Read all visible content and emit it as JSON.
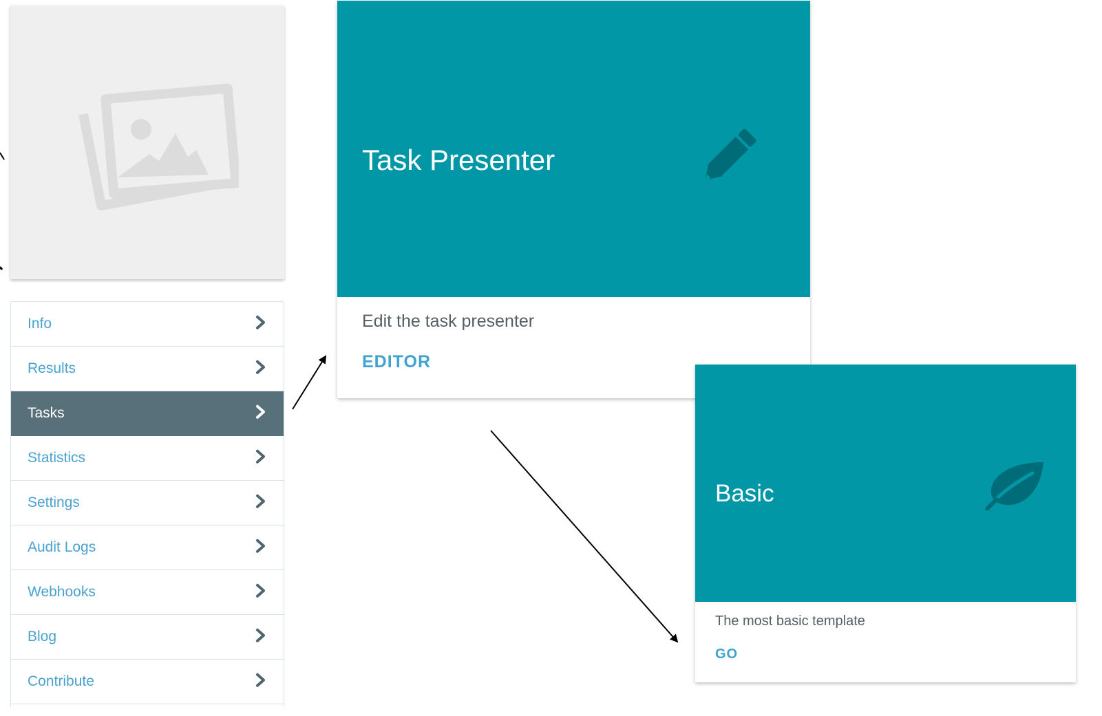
{
  "thumbnail": {
    "icon": "image-placeholder-icon"
  },
  "menu": {
    "items": [
      {
        "label": "Info",
        "active": false
      },
      {
        "label": "Results",
        "active": false
      },
      {
        "label": "Tasks",
        "active": true
      },
      {
        "label": "Statistics",
        "active": false
      },
      {
        "label": "Settings",
        "active": false
      },
      {
        "label": "Audit Logs",
        "active": false
      },
      {
        "label": "Webhooks",
        "active": false
      },
      {
        "label": "Blog",
        "active": false
      },
      {
        "label": "Contribute",
        "active": false
      }
    ]
  },
  "task_presenter_card": {
    "title": "Task Presenter",
    "description": "Edit the task presenter",
    "link": "EDITOR",
    "icon": "pencil-icon"
  },
  "basic_card": {
    "title": "Basic",
    "description": "The most basic template",
    "link": "GO",
    "icon": "leaf-icon"
  },
  "colors": {
    "teal": "#0297a7",
    "icon_dark": "#006c78",
    "link_blue": "#3fa3d2",
    "active_bg": "#587079"
  }
}
